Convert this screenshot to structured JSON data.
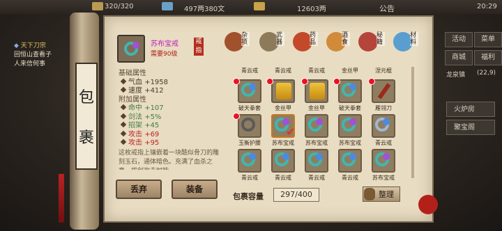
{
  "topbar": {
    "stamina": "320/320",
    "silver": "497两380文",
    "gold": "12603两",
    "notice_label": "公告",
    "time": "20:29"
  },
  "quest": {
    "title": "天下刀宗",
    "line1": "回恒山查看子",
    "line2": "人来信何事"
  },
  "right_menu": {
    "row1": [
      "活动",
      "菜单"
    ],
    "row2": [
      "商城",
      "福利"
    ],
    "location": "龙泉镇",
    "coords": "(22,9)",
    "btn_furnace": "火炉房",
    "btn_treasure": "聚宝阁"
  },
  "scroll": {
    "title_char1": "包",
    "title_char2": "裹"
  },
  "item": {
    "name": "苏布宝戒",
    "requirement": "需要90级",
    "tag": "戒指",
    "base_header": "基础属性",
    "base_stats": [
      {
        "label": "气血",
        "value": "+1958"
      },
      {
        "label": "速度",
        "value": "+412"
      }
    ],
    "extra_header": "附加属性",
    "extra_stats": [
      {
        "label": "命中",
        "value": "+107",
        "color": "green"
      },
      {
        "label": "剑法",
        "value": "+5%",
        "color": "green"
      },
      {
        "label": "招架",
        "value": "+45",
        "color": "green"
      },
      {
        "label": "攻击",
        "value": "+69",
        "color": "red"
      },
      {
        "label": "攻击",
        "value": "+95",
        "color": "red"
      }
    ],
    "description": "这枚戒指上镶嵌着一块酷似骨刀的雕刻玉石，通体暗色。充满了血杀之意，拔剑攻击时能"
  },
  "buttons": {
    "discard": "丢弃",
    "equip": "装备",
    "sort": "整理"
  },
  "categories": [
    {
      "label": "杂项"
    },
    {
      "label": "武器"
    },
    {
      "label": "药品"
    },
    {
      "label": "酒食"
    },
    {
      "label": "秘籍"
    },
    {
      "label": "材料"
    }
  ],
  "grid_row0_labels": [
    "青云戒",
    "青云戒",
    "青云戒",
    "金丝甲",
    "涅元棍"
  ],
  "grid_rows": [
    [
      "破天拳套",
      "金丝甲",
      "金丝甲",
      "破天拳套",
      "雁翎刀"
    ],
    [
      "玉衡护腰",
      "苏布宝戒",
      "苏布宝戒",
      "苏布宝戒",
      "青云戒"
    ],
    [
      "青云戒",
      "青云戒",
      "青云戒",
      "青云戒",
      "苏布宝戒"
    ]
  ],
  "capacity": {
    "label": "包裹容量",
    "value": "297/400"
  }
}
